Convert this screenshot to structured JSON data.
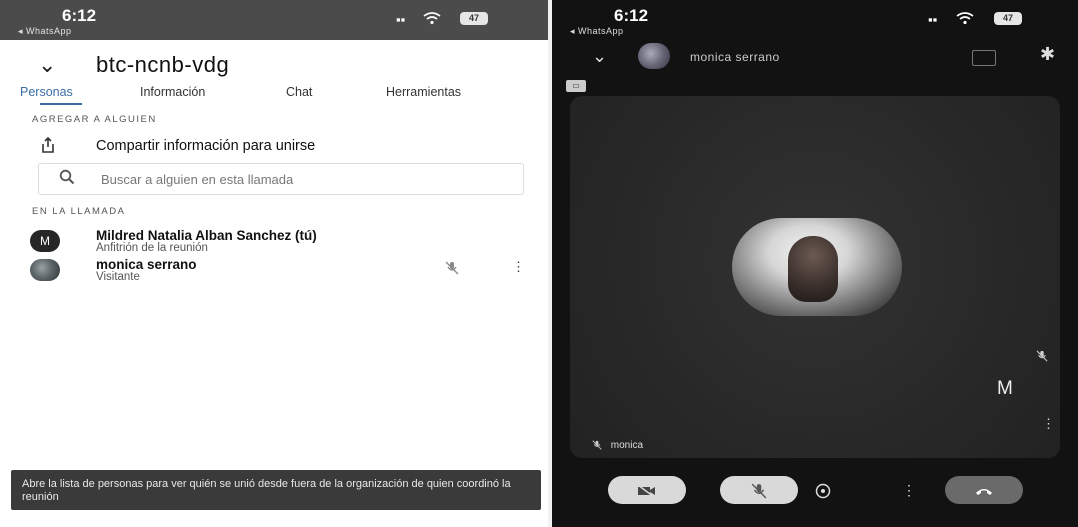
{
  "left": {
    "status": {
      "time": "6:12",
      "back_app": "◂ WhatsApp",
      "battery": "47"
    },
    "header": {
      "title": "btc-ncnb-vdg"
    },
    "tabs": [
      {
        "label": "Personas",
        "active": true
      },
      {
        "label": "Información",
        "active": false
      },
      {
        "label": "Chat",
        "active": false
      },
      {
        "label": "Herramientas",
        "active": false
      }
    ],
    "add_section": {
      "label": "AGREGAR A ALGUIEN",
      "share_label": "Compartir información para unirse",
      "search_placeholder": "Buscar a alguien en esta llamada"
    },
    "call_section": {
      "label": "EN LA LLAMADA",
      "participants": [
        {
          "name": "Mildred Natalia Alban Sanchez (tú)",
          "role": "Anfitrión de la reunión",
          "initial": "M"
        },
        {
          "name": "monica serrano",
          "role": "Visitante",
          "muted_icon": "mic-off-icon",
          "more_icon": "more-vert-icon"
        }
      ]
    },
    "toast": "Abre la lista de personas para ver quién se unió desde fuera de la organización de quien coordinó la reunión"
  },
  "right": {
    "status": {
      "time": "6:12",
      "back_app": "◂ WhatsApp",
      "battery": "47"
    },
    "header": {
      "participant_name": "monica serrano"
    },
    "tile": {
      "initial": "M",
      "label": "monica"
    },
    "controls": [
      "camera-off",
      "mic-off",
      "emoji",
      "more",
      "hang-up"
    ]
  }
}
